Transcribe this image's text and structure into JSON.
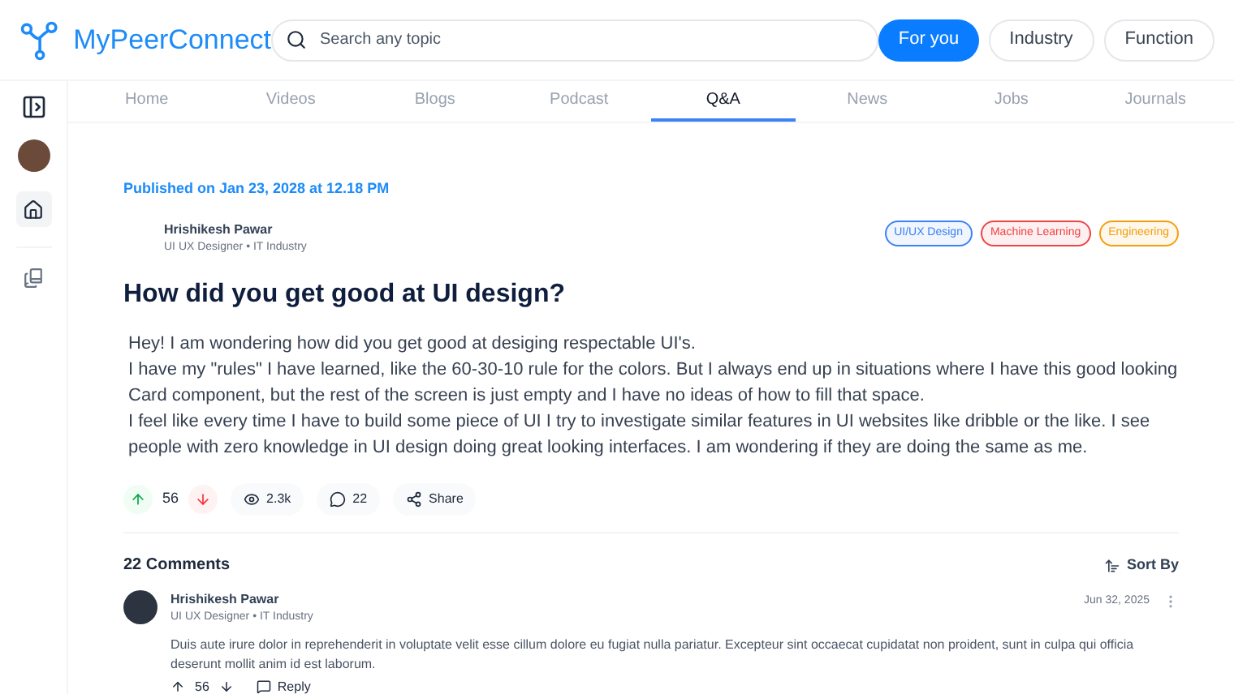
{
  "brand": {
    "name": "MyPeerConnect"
  },
  "search": {
    "placeholder": "Search any topic"
  },
  "filters": [
    {
      "label": "For you",
      "selected": true
    },
    {
      "label": "Industry",
      "selected": false
    },
    {
      "label": "Function",
      "selected": false
    }
  ],
  "tabs": [
    {
      "label": "Home",
      "selected": false
    },
    {
      "label": "Videos",
      "selected": false
    },
    {
      "label": "Blogs",
      "selected": false
    },
    {
      "label": "Podcast",
      "selected": false
    },
    {
      "label": "Q&A",
      "selected": true
    },
    {
      "label": "News",
      "selected": false
    },
    {
      "label": "Jobs",
      "selected": false
    },
    {
      "label": "Journals",
      "selected": false
    }
  ],
  "post": {
    "published": "Published on Jan 23, 2028 at 12.18 PM",
    "author": "Hrishikesh Pawar",
    "role": "UI UX Designer",
    "separator": "•",
    "industry": "IT Industry",
    "tags": [
      {
        "label": "UI/UX Design",
        "color": "#3b82f6"
      },
      {
        "label": "Machine Learning",
        "color": "#ef4444"
      },
      {
        "label": "Engineering",
        "color": "#f59e0b"
      }
    ],
    "title": "How did you get good at UI design?",
    "body": [
      "Hey!  I am wondering how did you get good at desiging respectable UI's.",
      "I have my \"rules\" I have learned, like the 60-30-10 rule for the  colors. But I always end up in situations where I have this good looking Card component, but the rest of the screen is just empty and I have no  ideas of how to fill that space.",
      "I feel like every time I have to build some piece of UI I try to  investigate similar features in UI websites like dribble or the like. I  see people with zero knowledge in UI design doing great looking  interfaces. I am wondering if they are doing the same as me."
    ],
    "votes": "56",
    "views": "2.3k",
    "comments": "22",
    "share": "Share"
  },
  "comments_header": {
    "title": "22 Comments",
    "sort": "Sort By"
  },
  "comments": [
    {
      "author": "Hrishikesh Pawar",
      "role": "UI UX Designer",
      "separator": "•",
      "industry": "IT Industry",
      "date": "Jun 32, 2025",
      "text": "Duis aute irure dolor in reprehenderit in voluptate velit esse cillum dolore eu fugiat nulla pariatur. Excepteur sint occaecat cupidatat non proident, sunt in culpa qui officia deserunt mollit anim id est laborum.",
      "votes": "56",
      "reply": "Reply"
    }
  ]
}
